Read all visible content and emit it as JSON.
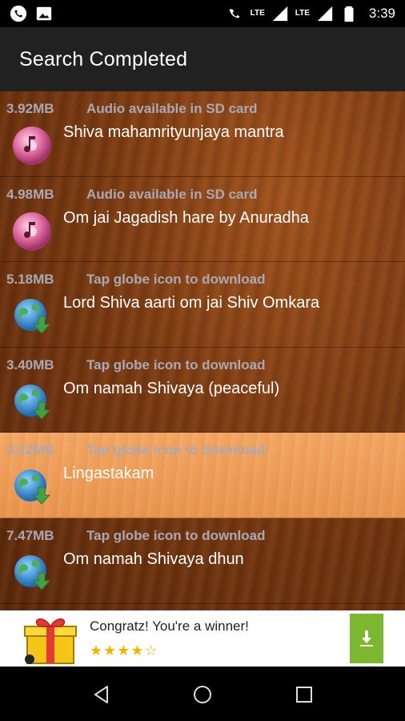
{
  "status_bar": {
    "left_icons": [
      "phone-call-icon",
      "image-icon"
    ],
    "network_1": "LTE",
    "network_2": "LTE",
    "time": "3:39"
  },
  "toolbar": {
    "title": "Search Completed"
  },
  "list": {
    "items": [
      {
        "size": "3.92MB",
        "status": "Audio available in SD card",
        "title": "Shiva mahamrityunjaya mantra",
        "icon": "music-disc-icon"
      },
      {
        "size": "4.98MB",
        "status": "Audio available in SD card",
        "title": "Om jai Jagadish hare by Anuradha",
        "icon": "music-disc-icon"
      },
      {
        "size": "5.18MB",
        "status": "Tap globe icon to download",
        "title": "Lord Shiva aarti  om jai Shiv Omkara",
        "icon": "globe-download-icon"
      },
      {
        "size": "3.40MB",
        "status": "Tap globe icon to download",
        "title": "Om namah Shivaya (peaceful)",
        "icon": "globe-download-icon"
      },
      {
        "size": "3.22MB",
        "status": "Tap globe icon to download",
        "title": "Lingastakam",
        "icon": "globe-download-icon",
        "selected": true
      },
      {
        "size": "7.47MB",
        "status": "Tap globe icon to download",
        "title": "Om namah Shivaya dhun",
        "icon": "globe-download-icon"
      }
    ]
  },
  "ad": {
    "headline": "Congratz! You're a winner!",
    "rating": 4.5,
    "stars": "★★★★☆",
    "icon": "gift-icon"
  },
  "nav_bar": {
    "buttons": [
      "back-icon",
      "home-icon",
      "recents-icon"
    ]
  }
}
